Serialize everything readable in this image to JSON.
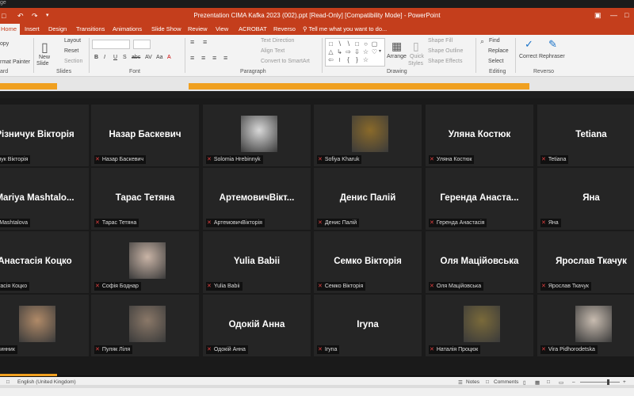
{
  "window": {
    "title": "Prezentation CIMA Kafka 2023 (002).ppt [Read-Only] [Compatibility Mode] - PowerPoint",
    "top_label": "ge"
  },
  "tabs": [
    {
      "label": "Home",
      "active": true
    },
    {
      "label": "Insert"
    },
    {
      "label": "Design"
    },
    {
      "label": "Transitions"
    },
    {
      "label": "Animations"
    },
    {
      "label": "Slide Show"
    },
    {
      "label": "Review"
    },
    {
      "label": "View"
    },
    {
      "label": "ACROBAT"
    },
    {
      "label": "Reverso"
    }
  ],
  "tell_me": "Tell me what you want to do...",
  "ribbon": {
    "clipboard": {
      "copy": "opy",
      "format_painter": "rmat Painter",
      "group": "ard"
    },
    "slides": {
      "new_slide": "New",
      "new_slide2": "Slide",
      "layout": "Layout",
      "reset": "Reset",
      "section": "Section",
      "group": "Slides"
    },
    "font": {
      "group": "Font",
      "buttons": [
        "B",
        "I",
        "U",
        "S",
        "abc",
        "AV",
        "Aa",
        "A"
      ]
    },
    "paragraph": {
      "text_direction": "Text Direction",
      "align_text": "Align Text",
      "convert": "Convert to SmartArt",
      "group": "Paragraph"
    },
    "drawing": {
      "arrange": "Arrange",
      "quick_styles": "Quick",
      "quick_styles2": "Styles",
      "shape_fill": "Shape Fill",
      "shape_outline": "Shape Outline",
      "shape_effects": "Shape Effects",
      "group": "Drawing"
    },
    "editing": {
      "find": "Find",
      "replace": "Replace",
      "select": "Select",
      "group": "Editing"
    },
    "reverso": {
      "correct": "Correct",
      "rephraser": "Rephraser",
      "group": "Reverso"
    }
  },
  "participants": [
    {
      "name": "Різничук Вікторія",
      "label": "ничук Вікторія",
      "photo": false
    },
    {
      "name": "Назар Баскевич",
      "label": "Назар Баскевич",
      "photo": false
    },
    {
      "name": "",
      "label": "Solomia Hrebinnyk",
      "photo": true,
      "photo_color": "#d8d8d8"
    },
    {
      "name": "",
      "label": "Sofiya Kharuk",
      "photo": true,
      "photo_color": "#8a6a2a"
    },
    {
      "name": "Уляна Костюк",
      "label": "Уляна Костюк",
      "photo": false
    },
    {
      "name": "Tetiana",
      "label": "Tetiana",
      "photo": false
    },
    {
      "name": "Mariya Mashtalo...",
      "label": "ya Mashtalova",
      "photo": false
    },
    {
      "name": "Тарас Тетяна",
      "label": "Тарас Тетяна",
      "photo": false
    },
    {
      "name": "АртемовичВікт...",
      "label": "АртемовичВікторія",
      "photo": false
    },
    {
      "name": "Денис Палій",
      "label": "Денис Палій",
      "photo": false
    },
    {
      "name": "Геренда Анаста...",
      "label": "Геренда Анастасія",
      "photo": false
    },
    {
      "name": "Яна",
      "label": "Яна",
      "photo": false
    },
    {
      "name": "Анастасія Коцко",
      "label": "астасія Коцко",
      "photo": false
    },
    {
      "name": "",
      "label": "Софія Боднар",
      "photo": true,
      "photo_color": "#c9b4a6"
    },
    {
      "name": "Yulia Babii",
      "label": "Yulia Babii",
      "photo": false
    },
    {
      "name": "Семко Вікторія",
      "label": "Семко Вікторія",
      "photo": false
    },
    {
      "name": "Оля Маційовська",
      "label": "Оля Маційовська",
      "photo": false
    },
    {
      "name": "Ярослав Ткачук",
      "label": "Ярослав Ткачук",
      "photo": false
    },
    {
      "name": "",
      "label": "я Винник",
      "photo": true,
      "photo_color": "#b08a68"
    },
    {
      "name": "",
      "label": "Пуляк Ліля",
      "photo": true,
      "photo_color": "#8a7868"
    },
    {
      "name": "Одокій Анна",
      "label": "Одокій Анна",
      "photo": false
    },
    {
      "name": "Iryna",
      "label": "Iryna",
      "photo": false
    },
    {
      "name": "",
      "label": "Наталія Процюк",
      "photo": true,
      "photo_color": "#7a6a3a"
    },
    {
      "name": "",
      "label": "Vira Pidhorodetska",
      "photo": true,
      "photo_color": "#c8bcb0"
    }
  ],
  "statusbar": {
    "language": "English (United Kingdom)",
    "notes": "Notes",
    "comments": "Comments"
  },
  "colors": {
    "accent": "#c43e1c",
    "tile": "#252525",
    "mic_off": "#e04040",
    "highlight": "#f0a020"
  }
}
